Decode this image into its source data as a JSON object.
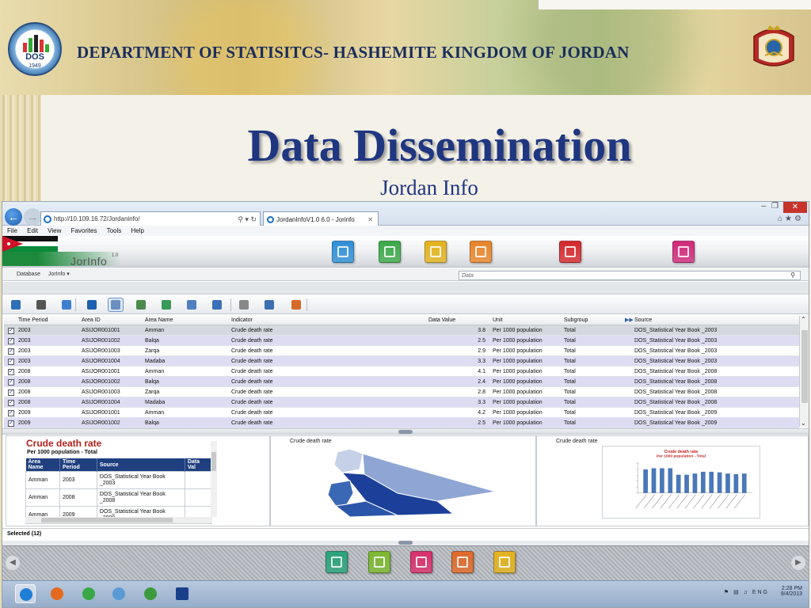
{
  "slide": {
    "header": "DEPARTMENT OF STATISITCS- HASHEMITE KINGDOM OF JORDAN",
    "logo_text": "DOS",
    "logo_year": "1949",
    "title": "Data Dissemination",
    "subtitle": "Jordan Info"
  },
  "browser": {
    "address": "http://10.109.16.72/Jordaninfo/",
    "tab_title": "JordanInfoV1.0 6.0 - Jorinfo",
    "menu": [
      "File",
      "Edit",
      "View",
      "Favorites",
      "Tools",
      "Help"
    ]
  },
  "app": {
    "name": "JorInfo",
    "version": "1.0",
    "database_label": "Database",
    "database_value": "JorInfo",
    "search_placeholder": "Data",
    "banner_tiles": [
      {
        "name": "tile-query-icon",
        "color": "#2f8fd6"
      },
      {
        "name": "tile-globe-icon",
        "color": "#3aa847"
      },
      {
        "name": "tile-check-icon",
        "color": "#e3b21c"
      },
      {
        "name": "tile-chart-icon",
        "color": "#e8842a"
      },
      {
        "name": "tile-table-icon",
        "color": "#d4282c"
      },
      {
        "name": "tile-export-icon",
        "color": "#d0287a"
      }
    ],
    "toolbar_icons": [
      "open-icon",
      "print-icon",
      "database-icon",
      "info-icon",
      "grid-view-icon",
      "pivot-icon",
      "refresh-icon",
      "edit-icon",
      "filter-icon",
      "calculator-icon",
      "note-icon",
      "report-icon"
    ]
  },
  "grid": {
    "columns": [
      "Time Period",
      "Area ID",
      "Area Name",
      "Indicator",
      "Data Value",
      "Unit",
      "Subgroup",
      "Source"
    ],
    "rows": [
      [
        "2003",
        "ASIJOR001001",
        "Amman",
        "Crude death rate",
        "3.8",
        "Per 1000 population",
        "Total",
        "DOS_Statistical Year Book _2003"
      ],
      [
        "2003",
        "ASIJOR001002",
        "Balqa",
        "Crude death rate",
        "2.5",
        "Per 1000 population",
        "Total",
        "DOS_Statistical Year Book _2003"
      ],
      [
        "2003",
        "ASIJOR001003",
        "Zarqa",
        "Crude death rate",
        "2.9",
        "Per 1000 population",
        "Total",
        "DOS_Statistical Year Book _2003"
      ],
      [
        "2003",
        "ASIJOR001004",
        "Madaba",
        "Crude death rate",
        "3.3",
        "Per 1000 population",
        "Total",
        "DOS_Statistical Year Book _2003"
      ],
      [
        "2008",
        "ASIJOR001001",
        "Amman",
        "Crude death rate",
        "4.1",
        "Per 1000 population",
        "Total",
        "DOS_Statistical Year Book _2008"
      ],
      [
        "2008",
        "ASIJOR001002",
        "Balqa",
        "Crude death rate",
        "2.4",
        "Per 1000 population",
        "Total",
        "DOS_Statistical Year Book _2008"
      ],
      [
        "2008",
        "ASIJOR001003",
        "Zarqa",
        "Crude death rate",
        "2.8",
        "Per 1000 population",
        "Total",
        "DOS_Statistical Year Book _2008"
      ],
      [
        "2008",
        "ASIJOR001004",
        "Madaba",
        "Crude death rate",
        "3.3",
        "Per 1000 population",
        "Total",
        "DOS_Statistical Year Book _2008"
      ],
      [
        "2009",
        "ASIJOR001001",
        "Amman",
        "Crude death rate",
        "4.2",
        "Per 1000 population",
        "Total",
        "DOS_Statistical Year Book _2009"
      ],
      [
        "2009",
        "ASIJOR001002",
        "Balqa",
        "Crude death rate",
        "2.5",
        "Per 1000 population",
        "Total",
        "DOS_Statistical Year Book _2009"
      ]
    ]
  },
  "panels": {
    "table": {
      "title": "Crude death rate",
      "subtitle": "Per 1000 population - Total",
      "columns": [
        "Area Name",
        "Time Period",
        "Source",
        "Data Val"
      ],
      "rows": [
        [
          "Amman",
          "2003",
          "DOS_Statistical Year Book _2003",
          ""
        ],
        [
          "Amman",
          "2008",
          "DOS_Statistical Year Book _2008",
          ""
        ],
        [
          "Amman",
          "2009",
          "DOS_Statistical Year Book _2009",
          ""
        ]
      ]
    },
    "map": {
      "title": "Crude death rate"
    },
    "chart": {
      "title": "Crude death rate",
      "inner_title": "Crude death rate",
      "inner_subtitle": "Per 1000 population - Total"
    }
  },
  "chart_data": {
    "type": "bar",
    "title": "Crude death rate",
    "subtitle": "Per 1000 population - Total",
    "values": [
      4.0,
      4.2,
      4.2,
      4.2,
      3.1,
      3.1,
      3.3,
      3.6,
      3.6,
      3.5,
      3.3,
      3.2,
      3.3
    ],
    "ylim": [
      0,
      5
    ],
    "bar_color": "#4a78b8"
  },
  "status": {
    "selected": "Selected (12)"
  },
  "dock_tiles": [
    {
      "name": "dock-help-icon",
      "color": "#2aa37a"
    },
    {
      "name": "dock-tools-icon",
      "color": "#7cb82f"
    },
    {
      "name": "dock-swap-icon",
      "color": "#d8306c"
    },
    {
      "name": "dock-book-icon",
      "color": "#e06a2a"
    },
    {
      "name": "dock-folder-icon",
      "color": "#e3b21c"
    }
  ],
  "taskbar": {
    "apps": [
      "ie-icon",
      "firefox-icon",
      "chrome-icon",
      "network-icon",
      "frog-icon",
      "photoshop-icon"
    ],
    "lang": "ENG",
    "time": "2:28 PM",
    "date": "9/4/2013"
  }
}
